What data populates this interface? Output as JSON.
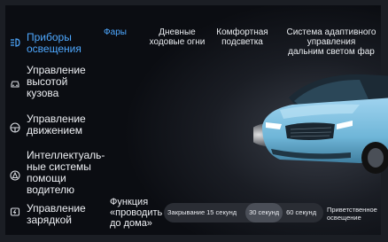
{
  "sidebar": {
    "items": [
      {
        "label": "Приборы\nосвещения",
        "icon": "headlight-icon",
        "active": true
      },
      {
        "label": "Управление\nвысотой\nкузова",
        "icon": "car-body-icon"
      },
      {
        "label": "Управление\nдвижением",
        "icon": "steering-wheel-icon"
      },
      {
        "label": "Интеллектуаль-\nные системы\nпомощи\nводителю",
        "icon": "driver-assist-icon"
      },
      {
        "label": "Управление\nзарядкой",
        "icon": "charging-icon"
      }
    ]
  },
  "tabs": [
    {
      "label": "Фары",
      "active": true
    },
    {
      "label": "Дневные\nходовые огни"
    },
    {
      "label": "Комфортная\nподсветка"
    },
    {
      "label": "Система адаптивного управления\nдальним светом фар"
    }
  ],
  "follow_home": {
    "label": "Функция\n«проводить\nдо дома»",
    "options": [
      "Закрывание",
      "15 секунд",
      "30 секунд",
      "60 секунд"
    ],
    "selected": "30 секунд",
    "extra": "Приветственное\nосвещение"
  },
  "colors": {
    "accent": "#4ea8ff",
    "car_body": "#6fb6d8",
    "background": "#0b0d12"
  }
}
